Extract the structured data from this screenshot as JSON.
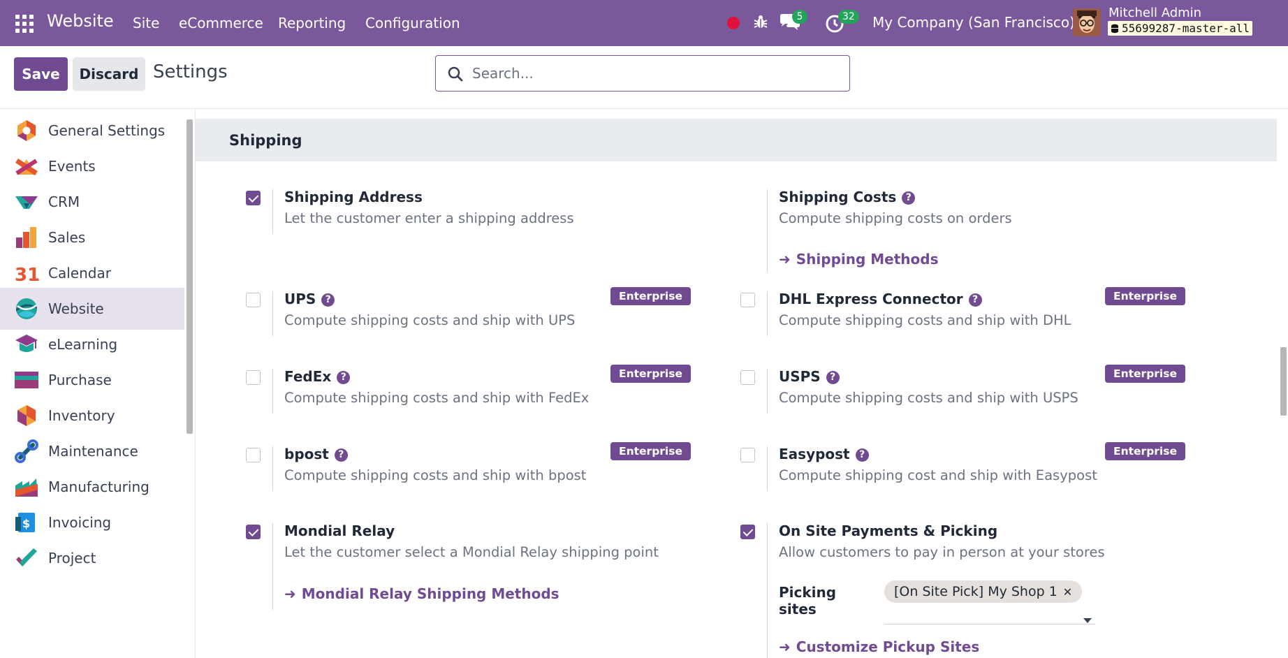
{
  "navbar": {
    "brand": "Website",
    "menus": [
      "Site",
      "eCommerce",
      "Reporting",
      "Configuration"
    ],
    "chat_count": "5",
    "activity_count": "32",
    "company": "My Company (San Francisco)",
    "user_name": "Mitchell Admin",
    "database": "55699287-master-all",
    "bg_color": "#7b579b"
  },
  "control": {
    "save_label": "Save",
    "discard_label": "Discard",
    "title": "Settings",
    "search_placeholder": "Search...",
    "search_value": ""
  },
  "sidebar": {
    "items": [
      {
        "label": "General Settings",
        "icon": "general-settings-icon"
      },
      {
        "label": "Events",
        "icon": "events-icon"
      },
      {
        "label": "CRM",
        "icon": "crm-icon"
      },
      {
        "label": "Sales",
        "icon": "sales-icon"
      },
      {
        "label": "Calendar",
        "icon": "calendar-icon"
      },
      {
        "label": "Website",
        "icon": "website-icon",
        "active": true
      },
      {
        "label": "eLearning",
        "icon": "elearning-icon"
      },
      {
        "label": "Purchase",
        "icon": "purchase-icon"
      },
      {
        "label": "Inventory",
        "icon": "inventory-icon"
      },
      {
        "label": "Maintenance",
        "icon": "maintenance-icon"
      },
      {
        "label": "Manufacturing",
        "icon": "manufacturing-icon"
      },
      {
        "label": "Invoicing",
        "icon": "invoicing-icon"
      },
      {
        "label": "Project",
        "icon": "project-icon"
      }
    ],
    "calendar_day": "31"
  },
  "section": {
    "title": "Shipping",
    "enterprise_label": "Enterprise",
    "settings": {
      "shipping_address": {
        "title": "Shipping Address",
        "desc": "Let the customer enter a shipping address",
        "checked": true
      },
      "shipping_costs": {
        "title": "Shipping Costs",
        "desc": "Compute shipping costs on orders",
        "link": "Shipping Methods"
      },
      "ups": {
        "title": "UPS",
        "desc": "Compute shipping costs and ship with UPS",
        "checked": false
      },
      "dhl": {
        "title": "DHL Express Connector",
        "desc": "Compute shipping costs and ship with DHL",
        "checked": false
      },
      "fedex": {
        "title": "FedEx",
        "desc": "Compute shipping costs and ship with FedEx",
        "checked": false
      },
      "usps": {
        "title": "USPS",
        "desc": "Compute shipping costs and ship with USPS",
        "checked": false
      },
      "bpost": {
        "title": "bpost",
        "desc": "Compute shipping costs and ship with bpost",
        "checked": false
      },
      "easypost": {
        "title": "Easypost",
        "desc": "Compute shipping cost and ship with Easypost",
        "checked": false
      },
      "mondial": {
        "title": "Mondial Relay",
        "desc": "Let the customer select a Mondial Relay shipping point",
        "checked": true,
        "link": "Mondial Relay Shipping Methods"
      },
      "onsite": {
        "title": "On Site Payments & Picking",
        "desc": "Allow customers to pay in person at your stores",
        "checked": true,
        "field_label": "Picking sites",
        "tag": "[On Site Pick] My Shop 1",
        "link": "Customize Pickup Sites"
      }
    }
  },
  "colors": {
    "accent": "#714b92",
    "badge": "#22a559",
    "record": "#e0123b"
  }
}
